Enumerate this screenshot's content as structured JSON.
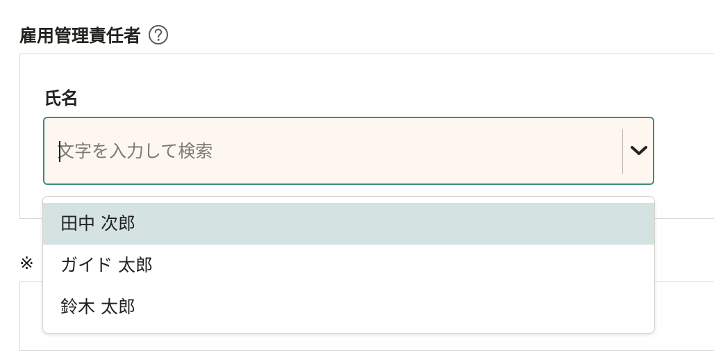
{
  "section": {
    "title": "雇用管理責任者",
    "help_icon": "question-circle-icon"
  },
  "field": {
    "label": "氏名",
    "placeholder": "文字を入力して検索",
    "value": "",
    "toggle_icon": "chevron-down-icon"
  },
  "dropdown": {
    "options": [
      {
        "label": "田中 次郎",
        "highlighted": true
      },
      {
        "label": "ガイド 太郎",
        "highlighted": false
      },
      {
        "label": "鈴木 太郎",
        "highlighted": false
      }
    ]
  },
  "note": {
    "text": "※"
  },
  "colors": {
    "focus_border": "#3e8d7e",
    "input_background": "#fdf7f0",
    "highlight": "#d5e2e2",
    "text": "#23221f"
  }
}
